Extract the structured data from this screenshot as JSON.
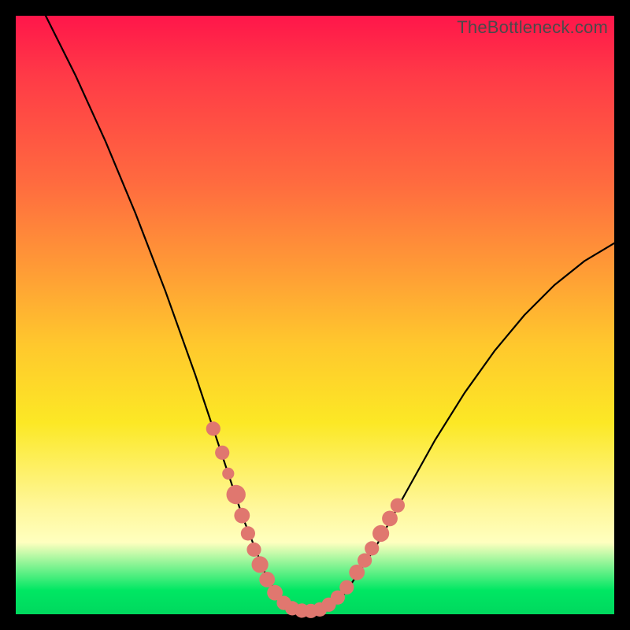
{
  "watermark": "TheBottleneck.com",
  "chart_data": {
    "type": "line",
    "title": "",
    "xlabel": "",
    "ylabel": "",
    "xlim": [
      0,
      100
    ],
    "ylim": [
      0,
      100
    ],
    "grid": false,
    "legend": false,
    "series": [
      {
        "name": "curve",
        "x": [
          5,
          10,
          15,
          20,
          25,
          30,
          33,
          36,
          38,
          40,
          42,
          44,
          46,
          48,
          50,
          52,
          55,
          60,
          65,
          70,
          75,
          80,
          85,
          90,
          95,
          100
        ],
        "y": [
          100,
          90,
          79,
          67,
          54,
          40,
          31,
          22,
          16,
          11,
          6,
          3,
          1.2,
          0.6,
          0.5,
          1.0,
          3.5,
          11,
          20,
          29,
          37,
          44,
          50,
          55,
          59,
          62
        ]
      }
    ],
    "markers": {
      "color": "#e0776f",
      "points": [
        {
          "x": 33.0,
          "y": 31.0,
          "r": 1.2
        },
        {
          "x": 34.5,
          "y": 27.0,
          "r": 1.2
        },
        {
          "x": 35.5,
          "y": 23.5,
          "r": 1.0
        },
        {
          "x": 36.8,
          "y": 20.0,
          "r": 1.6
        },
        {
          "x": 37.8,
          "y": 16.5,
          "r": 1.3
        },
        {
          "x": 38.8,
          "y": 13.5,
          "r": 1.2
        },
        {
          "x": 39.8,
          "y": 10.8,
          "r": 1.2
        },
        {
          "x": 40.8,
          "y": 8.3,
          "r": 1.4
        },
        {
          "x": 42.0,
          "y": 5.8,
          "r": 1.3
        },
        {
          "x": 43.3,
          "y": 3.6,
          "r": 1.3
        },
        {
          "x": 44.8,
          "y": 1.9,
          "r": 1.2
        },
        {
          "x": 46.2,
          "y": 1.0,
          "r": 1.2
        },
        {
          "x": 47.8,
          "y": 0.6,
          "r": 1.2
        },
        {
          "x": 49.3,
          "y": 0.55,
          "r": 1.2
        },
        {
          "x": 50.8,
          "y": 0.8,
          "r": 1.2
        },
        {
          "x": 52.3,
          "y": 1.6,
          "r": 1.2
        },
        {
          "x": 53.8,
          "y": 2.8,
          "r": 1.2
        },
        {
          "x": 55.3,
          "y": 4.5,
          "r": 1.2
        },
        {
          "x": 57.0,
          "y": 7.0,
          "r": 1.3
        },
        {
          "x": 58.3,
          "y": 9.0,
          "r": 1.2
        },
        {
          "x": 59.5,
          "y": 11.0,
          "r": 1.2
        },
        {
          "x": 61.0,
          "y": 13.5,
          "r": 1.4
        },
        {
          "x": 62.5,
          "y": 16.0,
          "r": 1.3
        },
        {
          "x": 63.8,
          "y": 18.2,
          "r": 1.2
        }
      ]
    },
    "background_gradient": {
      "direction": "vertical",
      "stops": [
        {
          "pos": 0.0,
          "color": "#ff164a"
        },
        {
          "pos": 0.28,
          "color": "#ff6b3f"
        },
        {
          "pos": 0.55,
          "color": "#ffc82d"
        },
        {
          "pos": 0.82,
          "color": "#fff79a"
        },
        {
          "pos": 0.96,
          "color": "#00e763"
        },
        {
          "pos": 1.0,
          "color": "#00d85e"
        }
      ]
    }
  }
}
